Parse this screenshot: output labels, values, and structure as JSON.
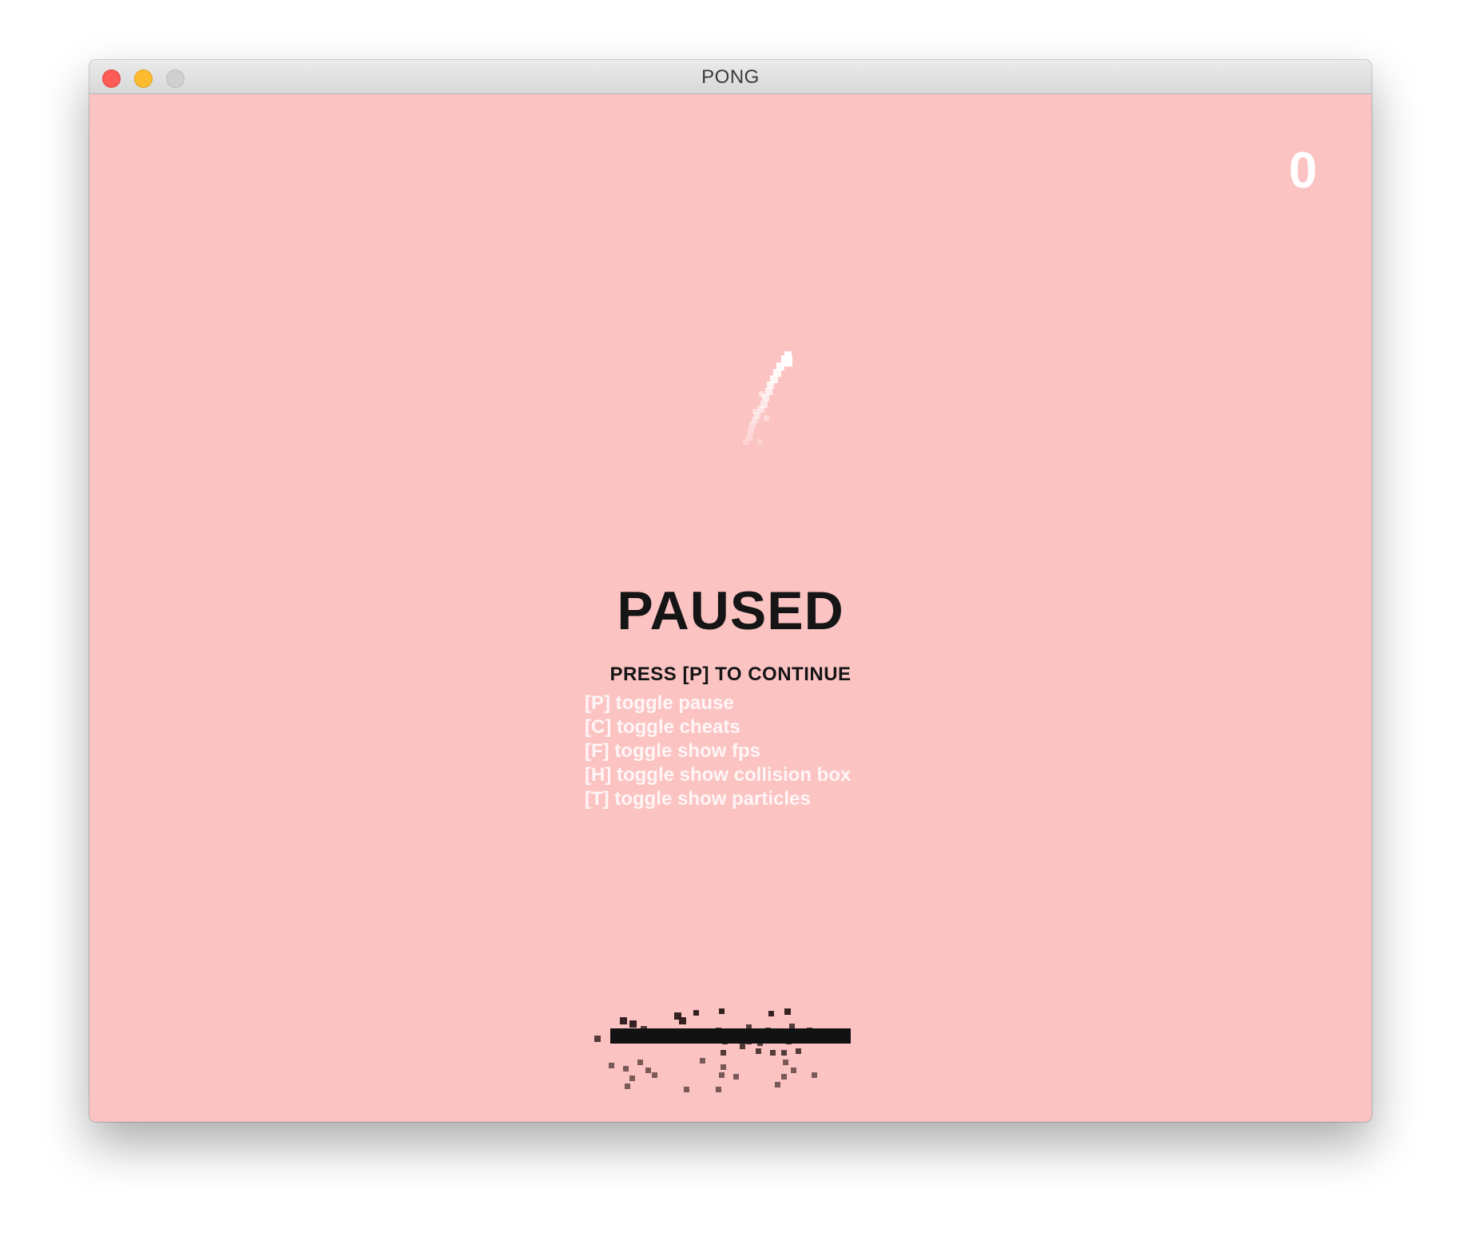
{
  "window": {
    "title": "PONG"
  },
  "game": {
    "score": "0",
    "pause_title": "PAUSED",
    "pause_prompt": "PRESS [P] TO CONTINUE",
    "help_lines": [
      "[P] toggle pause",
      "[C] toggle cheats",
      "[F] toggle show fps",
      "[H] toggle show collision box",
      "[T] toggle show particles"
    ]
  },
  "colors": {
    "background": "#fcc3c3",
    "paddle": "#121212",
    "ball": "#ffffff",
    "text_dark": "#151515",
    "text_light": "#ffffff"
  }
}
